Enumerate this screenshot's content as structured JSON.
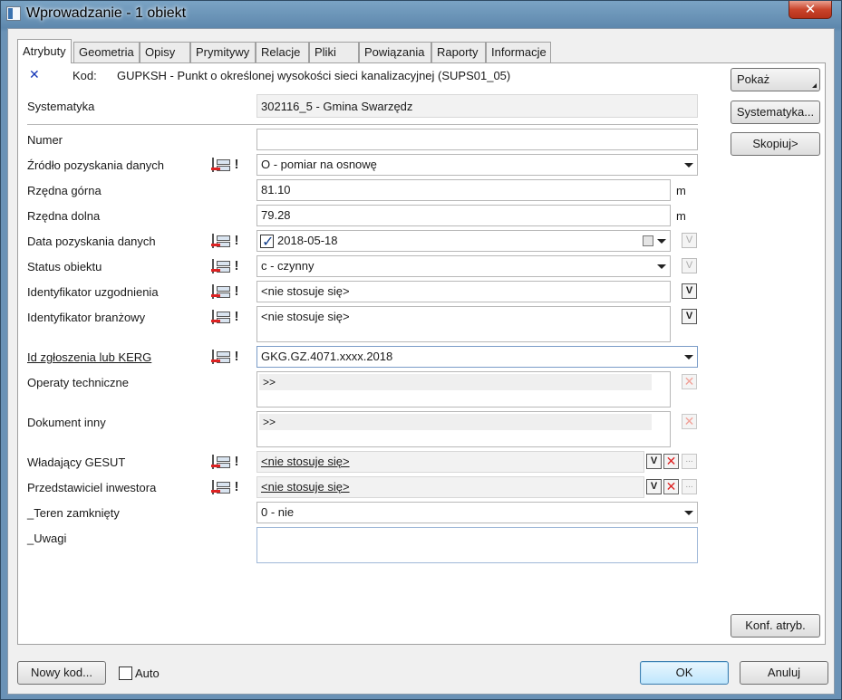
{
  "window": {
    "title": "Wprowadzanie - 1 obiekt",
    "close_glyph": "✕"
  },
  "tabs": [
    "Atrybuty",
    "Geometria",
    "Opisy",
    "Prymitywy",
    "Relacje",
    "Pliki",
    "Powiązania",
    "Raporty",
    "Informacje"
  ],
  "header": {
    "kod_label": "Kod:",
    "kod_value": "GUPKSH - Punkt o określonej wysokości sieci kanalizacyjnej (SUPS01_05)",
    "systematyka_label": "Systematyka",
    "systematyka_value": "302116_5 - Gmina Swarzędz"
  },
  "fields": {
    "numer": {
      "label": "Numer",
      "value": ""
    },
    "zrodlo": {
      "label": "Źródło pozyskania danych",
      "value": "O - pomiar na osnowę"
    },
    "rzedna_gorna": {
      "label": "Rzędna górna",
      "value": "81.10",
      "unit": "m"
    },
    "rzedna_dolna": {
      "label": "Rzędna dolna",
      "value": "79.28",
      "unit": "m"
    },
    "data_pozyskania": {
      "label": "Data pozyskania danych",
      "value": "2018-05-18",
      "checked": true
    },
    "status": {
      "label": "Status obiektu",
      "value": "c - czynny"
    },
    "id_uzgodnienia": {
      "label": "Identyfikator uzgodnienia",
      "value": "<nie stosuje się>"
    },
    "id_branzowy": {
      "label": "Identyfikator branżowy",
      "value": "<nie stosuje się>"
    },
    "id_zgloszenia": {
      "label": "Id zgłoszenia lub KERG",
      "value": "GKG.GZ.4071.xxxx.2018"
    },
    "operaty": {
      "label": "Operaty techniczne",
      "value": ">>"
    },
    "dokument": {
      "label": "Dokument inny",
      "value": ">>"
    },
    "wladajacy": {
      "label": "Władający GESUT",
      "value": "<nie stosuje się>"
    },
    "przedstawiciel": {
      "label": "Przedstawiciel inwestora",
      "value": "<nie stosuje się>"
    },
    "teren": {
      "label": "_Teren zamknięty",
      "value": "0 - nie"
    },
    "uwagi": {
      "label": "_Uwagi",
      "value": ""
    }
  },
  "glyphs": {
    "v": "V",
    "x": "✕",
    "dots": "...",
    "check": "✓",
    "remove": "✕"
  },
  "right_buttons": {
    "pokaz": "Pokaż",
    "systematyka": "Systematyka...",
    "skopiuj": "Skopiuj>",
    "konf": "Konf. atryb."
  },
  "footer": {
    "nowy_kod": "Nowy kod...",
    "auto": "Auto",
    "ok": "OK",
    "anuluj": "Anuluj"
  }
}
